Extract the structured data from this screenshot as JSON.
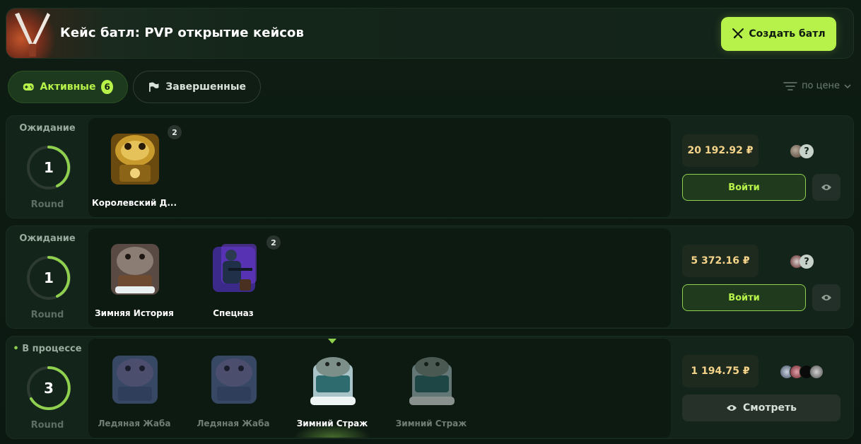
{
  "header": {
    "title": "Кейс батл: PVP открытие кейсов",
    "create_label": "Создать батл",
    "accent": "#b6f24a"
  },
  "tabs": {
    "active": {
      "label": "Активные",
      "count": "6"
    },
    "finished": {
      "label": "Завершенные"
    }
  },
  "sort": {
    "label": "по цене"
  },
  "battles": [
    {
      "status": "Ожидание",
      "round": "1",
      "round_label": "Round",
      "cases": [
        {
          "name": "Королевский Д...",
          "count": "2",
          "icon": "gold-toad-case"
        }
      ],
      "price": "20 192.92 ₽",
      "players": [
        "avatar",
        "unknown"
      ],
      "join_label": "Войти"
    },
    {
      "status": "Ожидание",
      "round": "1",
      "round_label": "Round",
      "cases": [
        {
          "name": "Зимняя История",
          "icon": "winter-toad-case"
        },
        {
          "name": "Спецназ",
          "count": "2",
          "icon": "spetsnaz-case"
        }
      ],
      "price": "5 372.16 ₽",
      "players": [
        "avatar",
        "unknown"
      ],
      "join_label": "Войти"
    },
    {
      "status": "В процессе",
      "round": "3",
      "round_label": "Round",
      "cases": [
        {
          "name": "Ледяная Жаба",
          "icon": "ice-toad-case"
        },
        {
          "name": "Ледяная Жаба",
          "icon": "ice-toad-case"
        },
        {
          "name": "Зимний Страж",
          "icon": "winter-guard-case"
        },
        {
          "name": "Зимний Страж",
          "icon": "winter-guard-case"
        }
      ],
      "price": "1 194.75 ₽",
      "players": [
        "avatar",
        "avatar",
        "avatar",
        "avatar"
      ],
      "watch_label": "Смотреть"
    }
  ]
}
